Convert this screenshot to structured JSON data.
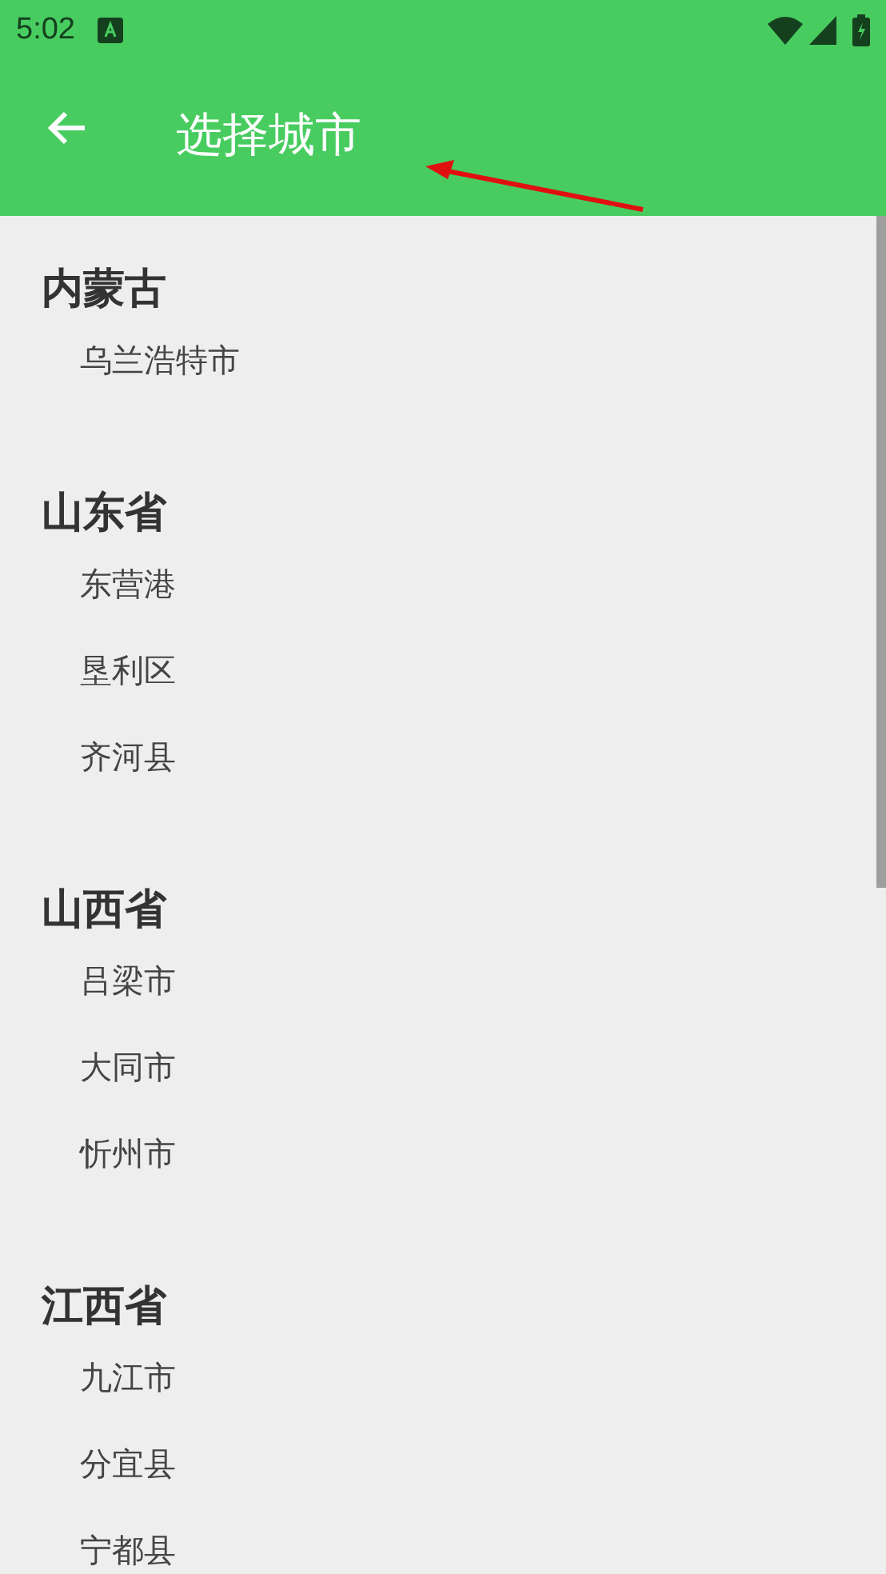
{
  "status_bar": {
    "time": "5:02"
  },
  "app_bar": {
    "title": "选择城市"
  },
  "groups": [
    {
      "province": "内蒙古",
      "cities": [
        "乌兰浩特市"
      ]
    },
    {
      "province": "山东省",
      "cities": [
        "东营港",
        "垦利区",
        "齐河县"
      ]
    },
    {
      "province": "山西省",
      "cities": [
        "吕梁市",
        "大同市",
        "忻州市"
      ]
    },
    {
      "province": "江西省",
      "cities": [
        "九江市",
        "分宜县",
        "宁都县"
      ]
    }
  ]
}
